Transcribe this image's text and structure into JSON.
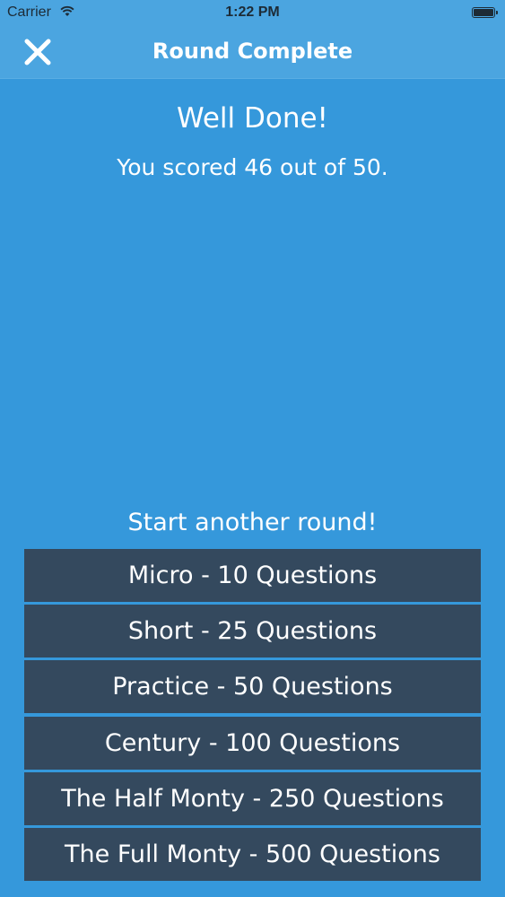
{
  "status_bar": {
    "carrier": "Carrier",
    "time": "1:22 PM",
    "battery_level": 1.0,
    "icons": [
      "wifi-icon",
      "battery-icon"
    ]
  },
  "nav": {
    "title": "Round Complete",
    "close_icon": "close-icon"
  },
  "result": {
    "heading": "Well Done!",
    "score_text": "You scored 46 out of 50."
  },
  "rounds": {
    "prompt": "Start another round!",
    "options": [
      {
        "label": "Micro - 10 Questions"
      },
      {
        "label": "Short - 25 Questions"
      },
      {
        "label": "Practice - 50 Questions"
      },
      {
        "label": "Century - 100 Questions"
      },
      {
        "label": "The Half Monty - 250 Questions"
      },
      {
        "label": "The Full Monty - 500 Questions"
      }
    ]
  },
  "colors": {
    "background": "#3598db",
    "nav_background": "#4ba5e0",
    "button_background": "#34495e",
    "text": "#ffffff"
  }
}
